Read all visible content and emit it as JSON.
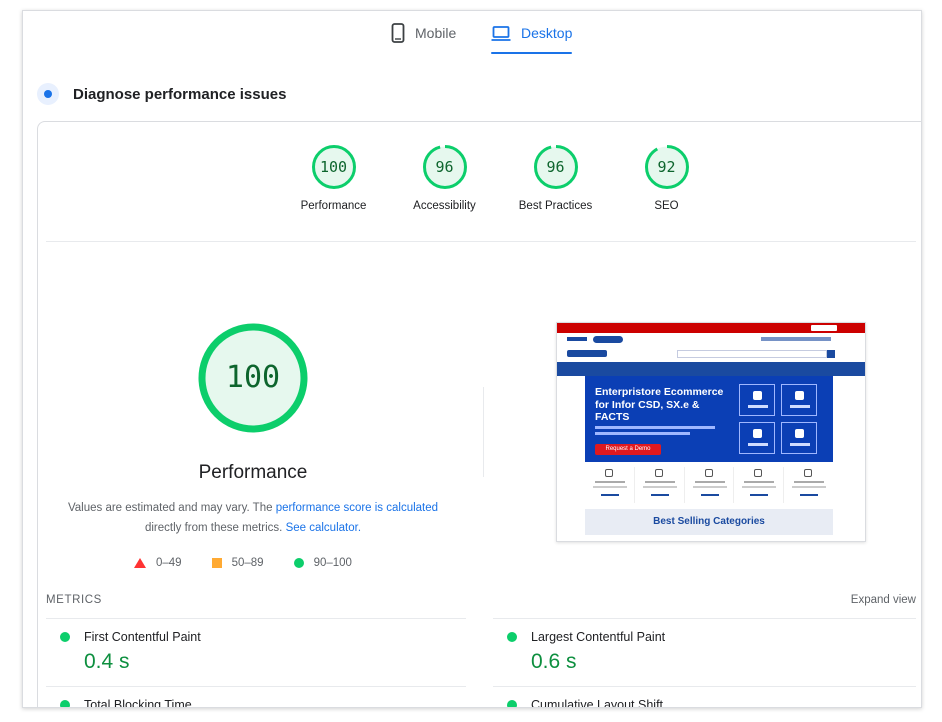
{
  "tabs": {
    "mobile_label": "Mobile",
    "desktop_label": "Desktop",
    "active": "Desktop"
  },
  "diagnose": {
    "title": "Diagnose performance issues"
  },
  "scores": [
    {
      "value": "100",
      "fraction": 1.0,
      "label": "Performance"
    },
    {
      "value": "96",
      "fraction": 0.96,
      "label": "Accessibility"
    },
    {
      "value": "96",
      "fraction": 0.96,
      "label": "Best Practices"
    },
    {
      "value": "92",
      "fraction": 0.92,
      "label": "SEO"
    }
  ],
  "performance": {
    "score": "100",
    "fraction": 1.0,
    "title": "Performance",
    "desc_prefix": "Values are estimated and may vary. The ",
    "desc_link1": "performance score is calculated",
    "desc_mid": " directly from these metrics. ",
    "desc_link2": "See calculator."
  },
  "legend": {
    "fail": "0–49",
    "average": "50–89",
    "pass": "90–100"
  },
  "screenshot": {
    "hero_title": "Enterpristore Ecommerce for Infor CSD, SX.e & FACTS",
    "cta": "Request a Demo",
    "best_selling": "Best Selling Categories"
  },
  "metrics": {
    "heading": "METRICS",
    "expand": "Expand view",
    "items": [
      {
        "name": "First Contentful Paint",
        "value": "0.4 s"
      },
      {
        "name": "Largest Contentful Paint",
        "value": "0.6 s"
      },
      {
        "name": "Total Blocking Time",
        "value": ""
      },
      {
        "name": "Cumulative Layout Shift",
        "value": ""
      }
    ]
  },
  "colors": {
    "accent": "#1a73e8",
    "pass": "#0cce6b",
    "pass_text": "#0d652d",
    "average": "#ffaa33",
    "fail": "#ff3333"
  }
}
